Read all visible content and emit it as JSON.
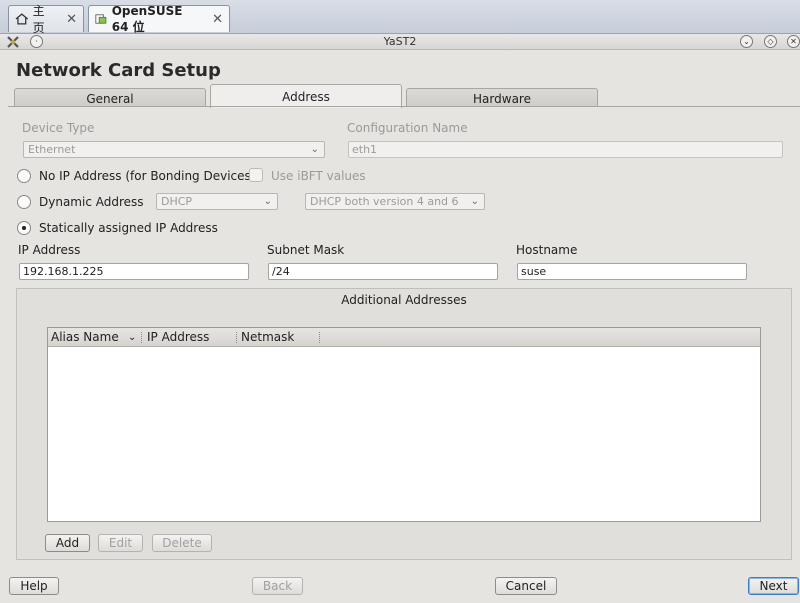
{
  "vm_tabs": [
    {
      "label": "主页",
      "close": "✕"
    },
    {
      "label": "OpenSUSE 64 位",
      "close": "✕"
    }
  ],
  "window": {
    "title": "YaST2"
  },
  "page_title": "Network Card Setup",
  "tabs": [
    {
      "label": "General",
      "selected": false
    },
    {
      "label": "Address",
      "selected": true
    },
    {
      "label": "Hardware",
      "selected": false
    }
  ],
  "device_type": {
    "label": "Device Type",
    "value": "Ethernet"
  },
  "config_name": {
    "label": "Configuration Name",
    "value": "eth1"
  },
  "options": {
    "no_ip": "No IP Address (for Bonding Devices)",
    "use_ibft": "Use iBFT values",
    "dynamic": "Dynamic Address",
    "dhcp_mode": "DHCP",
    "dhcp_version": "DHCP both version 4 and 6",
    "static": "Statically assigned IP Address",
    "selected": "static"
  },
  "fields": {
    "ip_label": "IP Address",
    "ip_value": "192.168.1.225",
    "subnet_label": "Subnet Mask",
    "subnet_value": "/24",
    "hostname_label": "Hostname",
    "hostname_value": "suse"
  },
  "additional": {
    "title": "Additional Addresses",
    "columns": [
      "Alias Name",
      "IP Address",
      "Netmask"
    ],
    "rows": [],
    "add": "Add",
    "edit": "Edit",
    "delete": "Delete"
  },
  "footer": {
    "help": "Help",
    "back": "Back",
    "cancel": "Cancel",
    "next": "Next"
  }
}
